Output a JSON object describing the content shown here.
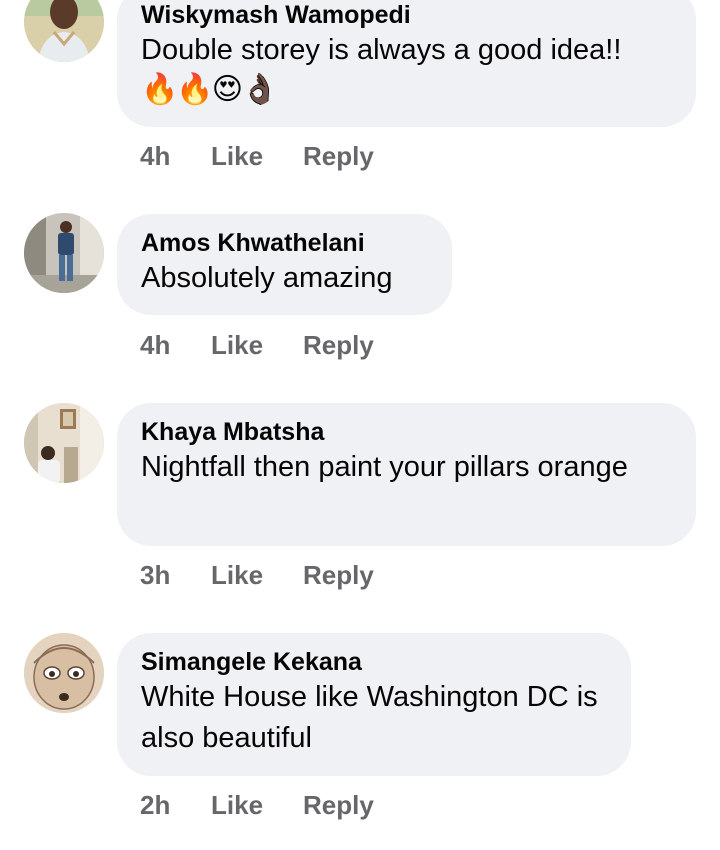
{
  "comments": [
    {
      "author": "Wiskymash Wamopedi",
      "text": "Double storey is always a good idea!!",
      "emojis": "🔥🔥😍👌🏿",
      "time": "4h",
      "like_label": "Like",
      "reply_label": "Reply"
    },
    {
      "author": "Amos Khwathelani",
      "text": "Absolutely amazing",
      "time": "4h",
      "like_label": "Like",
      "reply_label": "Reply"
    },
    {
      "author": "Khaya Mbatsha",
      "text": "Nightfall then paint your pillars orange",
      "time": "3h",
      "like_label": "Like",
      "reply_label": "Reply"
    },
    {
      "author": "Simangele Kekana",
      "text": "White House like Washington DC is also beautiful",
      "time": "2h",
      "like_label": "Like",
      "reply_label": "Reply"
    }
  ],
  "colors": {
    "bubble_bg": "#f0f1f4",
    "meta_text": "#65676b",
    "primary_text": "#050505"
  }
}
